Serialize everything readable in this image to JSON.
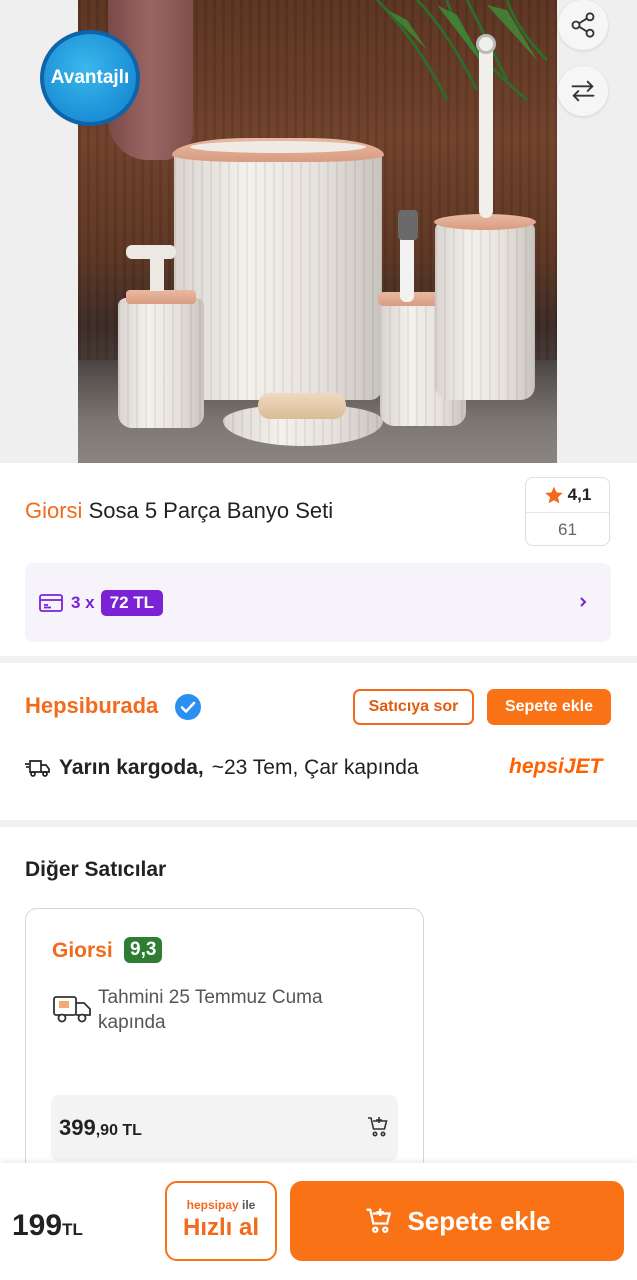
{
  "hero": {
    "badge": "Avantajlı"
  },
  "product": {
    "brand": "Giorsi",
    "name": "Sosa 5 Parça Banyo Seti",
    "rating": "4,1",
    "review_count": "61"
  },
  "installment": {
    "count_label": "3 x",
    "amount": "72 TL"
  },
  "seller": {
    "name": "Hepsiburada",
    "ask_label": "Satıcıya sor",
    "add_label": "Sepete ekle",
    "delivery_bold": "Yarın kargoda,",
    "delivery_text": "~23 Tem, Çar kapında",
    "carrier_a": "hepsi",
    "carrier_b": "JET"
  },
  "other_sellers": {
    "title": "Diğer Satıcılar",
    "items": [
      {
        "name": "Giorsi",
        "score": "9,3",
        "eta": "Tahmini 25 Temmuz Cuma kapında",
        "price_main": "399",
        "price_rest": ",90 TL"
      }
    ]
  },
  "bottom_bar": {
    "price_main": "199",
    "price_currency": "TL",
    "fast_brand": "hepsipay",
    "fast_brand_suffix": "ile",
    "fast_label": "Hızlı al",
    "add_to_cart": "Sepete ekle"
  },
  "colors": {
    "brand_orange": "#f97316",
    "seller_orange": "#f26a1b",
    "installment_purple": "#7b22d6",
    "score_green": "#2f7d32",
    "verified_blue": "#2a8ff0"
  }
}
